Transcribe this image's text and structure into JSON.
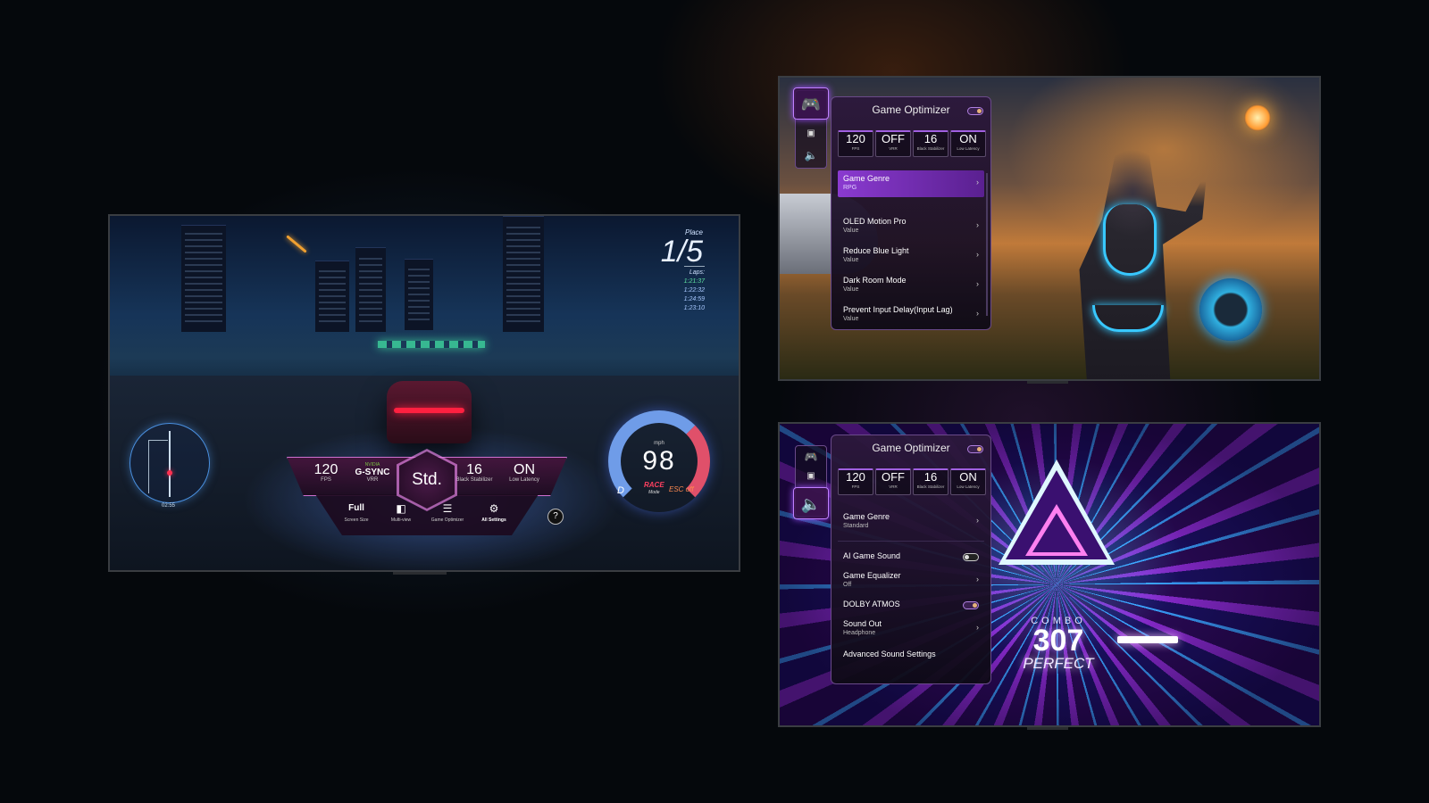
{
  "racing_tv": {
    "place_label": "Place",
    "place_value": "1/5",
    "laps_label": "Laps:",
    "laps": [
      "1:21:37",
      "1:22:32",
      "1:24:59",
      "1:23:10"
    ],
    "minimap_time": "02:55",
    "speed_unit": "mph",
    "speed": "98",
    "gear": "D",
    "mode": "RACE",
    "mode_label": "Mode",
    "esc": "ESC off",
    "game_bar": {
      "stats": [
        {
          "value": "120",
          "label": "FPS"
        },
        {
          "value": "G-SYNC",
          "label": "VRR",
          "brand": "NVIDIA"
        },
        {
          "value": "16",
          "label": "Black Stabilizer"
        },
        {
          "value": "ON",
          "label": "Low Latency"
        }
      ],
      "mode": "Std.",
      "buttons": [
        {
          "icon": "Full",
          "label": "Screen Size"
        },
        {
          "icon": "◧",
          "label": "Multi-view"
        },
        {
          "icon": "☰",
          "label": "Game Optimizer"
        },
        {
          "icon": "⚙",
          "label": "All Settings"
        }
      ],
      "help": "?"
    }
  },
  "rpg_tv": {
    "panel": {
      "title": "Game Optimizer",
      "toggle_on": true,
      "sidebar": [
        {
          "icon": "gamepad-icon",
          "glyph": "🎮",
          "active": true
        },
        {
          "icon": "picture-icon",
          "glyph": "▣",
          "active": false
        },
        {
          "icon": "speaker-icon",
          "glyph": "🔈",
          "active": false
        }
      ],
      "stats": [
        {
          "value": "120",
          "label": "FPS"
        },
        {
          "value": "OFF",
          "label": "VRR"
        },
        {
          "value": "16",
          "label": "Black Stabilizer"
        },
        {
          "value": "ON",
          "label": "Low Latency"
        }
      ],
      "items": [
        {
          "title": "Game Genre",
          "sub": "RPG",
          "selected": true
        },
        {
          "title": "OLED Motion Pro",
          "sub": "Value"
        },
        {
          "title": "Reduce Blue Light",
          "sub": "Value"
        },
        {
          "title": "Dark Room Mode",
          "sub": "Value"
        },
        {
          "title": "Prevent Input Delay(Input Lag)",
          "sub": "Value"
        }
      ]
    }
  },
  "rhythm_tv": {
    "combo_label": "COMBO",
    "combo_value": "307",
    "judgement": "PERFECT",
    "panel": {
      "title": "Game Optimizer",
      "toggle_on": true,
      "stats": [
        {
          "value": "120",
          "label": "FPS"
        },
        {
          "value": "OFF",
          "label": "VRR"
        },
        {
          "value": "16",
          "label": "Black Stabilizer"
        },
        {
          "value": "ON",
          "label": "Low Latency"
        }
      ],
      "items": [
        {
          "title": "Game Genre",
          "sub": "Standard",
          "type": "arrow"
        },
        {
          "title": "AI Game Sound",
          "type": "toggle",
          "on": false
        },
        {
          "title": "Game Equalizer",
          "sub": "Off",
          "type": "arrow"
        },
        {
          "title": "DOLBY ATMOS",
          "type": "toggle",
          "on": true
        },
        {
          "title": "Sound Out",
          "sub": "Headphone",
          "type": "arrow"
        },
        {
          "title": "Advanced Sound Settings",
          "type": "none"
        }
      ]
    }
  },
  "chevron": "›"
}
